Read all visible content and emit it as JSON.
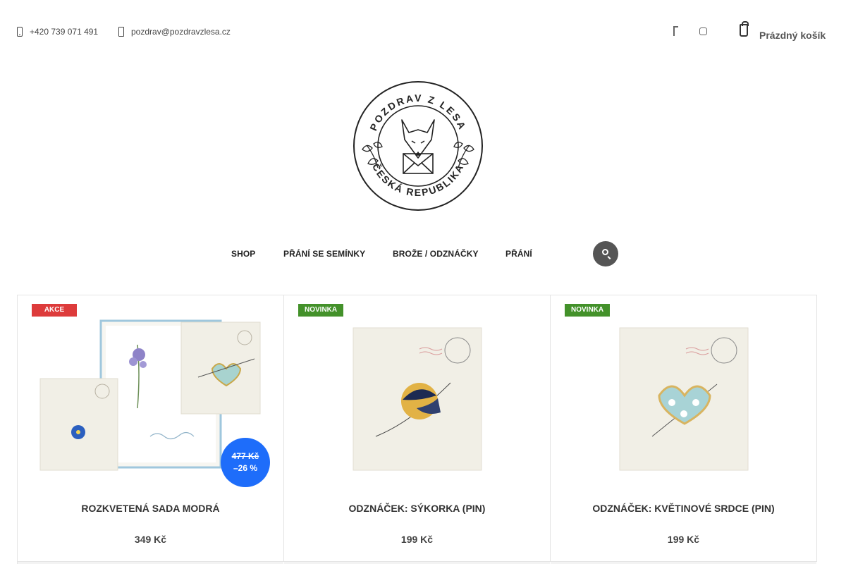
{
  "header": {
    "phone": "+420 739 071 491",
    "email": "pozdrav@pozdravzlesa.cz",
    "cart_label": "Prázdný košík",
    "social_icons": [
      "facebook-icon",
      "instagram-icon"
    ]
  },
  "logo": {
    "top_text": "POZDRAV Z LESA",
    "bottom_text": "ČESKÁ REPUBLIKA"
  },
  "nav": {
    "items": [
      "SHOP",
      "PŘÁNÍ SE SEMÍNKY",
      "BROŽE / ODZNÁČKY",
      "PŘÁNÍ"
    ],
    "search_icon": "search-icon"
  },
  "products": [
    {
      "flag": "AKCE",
      "flag_color": "#dd3b3b",
      "name": "ROZKVETENÁ SADA MODRÁ",
      "price": "349 Kč",
      "old_price": "477 Kč",
      "discount": "–26 %"
    },
    {
      "flag": "NOVINKA",
      "flag_color": "#43912a",
      "name": "ODZNÁČEK: SÝKORKA (PIN)",
      "price": "199 Kč"
    },
    {
      "flag": "NOVINKA",
      "flag_color": "#43912a",
      "name": "ODZNÁČEK: KVĚTINOVÉ SRDCE (PIN)",
      "price": "199 Kč"
    }
  ],
  "colors": {
    "discount_badge": "#1e6dfa",
    "search_button": "#555555"
  }
}
